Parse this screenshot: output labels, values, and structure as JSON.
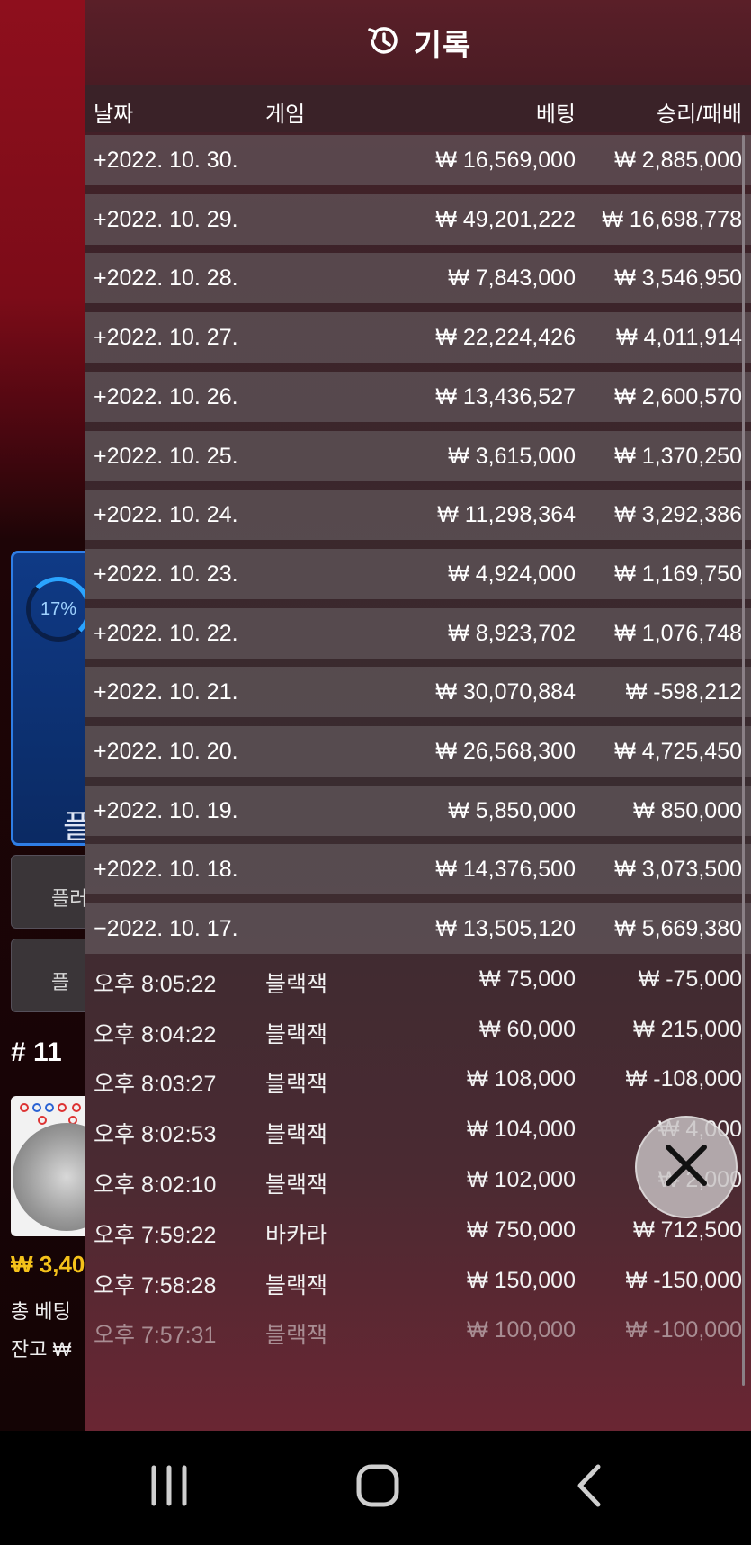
{
  "panel": {
    "title": "기록",
    "columns": {
      "date": "날짜",
      "game": "게임",
      "bet": "베팅",
      "result": "승리/패배"
    }
  },
  "daily_rows": [
    {
      "date": "+2022. 10. 30.",
      "bet": "₩ 16,569,000",
      "result": "₩ 2,885,000"
    },
    {
      "date": "+2022. 10. 29.",
      "bet": "₩ 49,201,222",
      "result": "₩ 16,698,778"
    },
    {
      "date": "+2022. 10. 28.",
      "bet": "₩ 7,843,000",
      "result": "₩ 3,546,950"
    },
    {
      "date": "+2022. 10. 27.",
      "bet": "₩ 22,224,426",
      "result": "₩ 4,011,914"
    },
    {
      "date": "+2022. 10. 26.",
      "bet": "₩ 13,436,527",
      "result": "₩ 2,600,570"
    },
    {
      "date": "+2022. 10. 25.",
      "bet": "₩ 3,615,000",
      "result": "₩ 1,370,250"
    },
    {
      "date": "+2022. 10. 24.",
      "bet": "₩ 11,298,364",
      "result": "₩ 3,292,386"
    },
    {
      "date": "+2022. 10. 23.",
      "bet": "₩ 4,924,000",
      "result": "₩ 1,169,750"
    },
    {
      "date": "+2022. 10. 22.",
      "bet": "₩ 8,923,702",
      "result": "₩ 1,076,748"
    },
    {
      "date": "+2022. 10. 21.",
      "bet": "₩ 30,070,884",
      "result": "₩ -598,212"
    },
    {
      "date": "+2022. 10. 20.",
      "bet": "₩ 26,568,300",
      "result": "₩ 4,725,450"
    },
    {
      "date": "+2022. 10. 19.",
      "bet": "₩ 5,850,000",
      "result": "₩ 850,000"
    },
    {
      "date": "+2022. 10. 18.",
      "bet": "₩ 14,376,500",
      "result": "₩ 3,073,500"
    },
    {
      "date": "−2022. 10. 17.",
      "bet": "₩ 13,505,120",
      "result": "₩ 5,669,380"
    }
  ],
  "session_rows": [
    {
      "time": "오후 8:05:22",
      "game": "블랙잭",
      "bet": "₩ 75,000",
      "result": "₩ -75,000"
    },
    {
      "time": "오후 8:04:22",
      "game": "블랙잭",
      "bet": "₩ 60,000",
      "result": "₩ 215,000"
    },
    {
      "time": "오후 8:03:27",
      "game": "블랙잭",
      "bet": "₩ 108,000",
      "result": "₩ -108,000"
    },
    {
      "time": "오후 8:02:53",
      "game": "블랙잭",
      "bet": "₩ 104,000",
      "result": "₩ 4,000"
    },
    {
      "time": "오후 8:02:10",
      "game": "블랙잭",
      "bet": "₩ 102,000",
      "result": "₩ 2,000"
    },
    {
      "time": "오후 7:59:22",
      "game": "바카라",
      "bet": "₩ 750,000",
      "result": "₩ 712,500"
    },
    {
      "time": "오후 7:58:28",
      "game": "블랙잭",
      "bet": "₩ 150,000",
      "result": "₩ -150,000"
    },
    {
      "time": "오후 7:57:31",
      "game": "블랙잭",
      "bet": "₩ 100,000",
      "result": "₩ -100,000"
    }
  ],
  "background": {
    "progress_percent": "17%",
    "card_label": "플",
    "button1": "플러",
    "button2": "플",
    "table_number": "# 11",
    "amount": "₩ 3,40",
    "total_bet_label": "총 베팅",
    "balance_label": "잔고 ₩"
  },
  "colors": {
    "accent_red": "#8e0f1d",
    "panel": "#3c2329",
    "gold": "#f4c21b"
  },
  "icons": {
    "header": "history-icon",
    "close": "close-icon",
    "nav": [
      "recents-icon",
      "home-icon",
      "back-icon"
    ]
  }
}
